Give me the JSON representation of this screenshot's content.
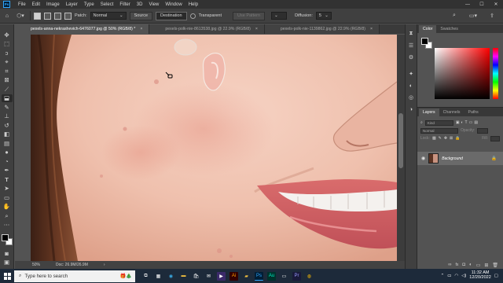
{
  "menubar": {
    "logo": "Ps",
    "items": [
      "File",
      "Edit",
      "Image",
      "Layer",
      "Type",
      "Select",
      "Filter",
      "3D",
      "View",
      "Window",
      "Help"
    ],
    "window_controls": [
      "—",
      "☐",
      "✕"
    ]
  },
  "options": {
    "patch_label": "Patch:",
    "patch_value": "Normal",
    "source_label": "Source",
    "destination_label": "Destination",
    "transparent_label": "Transparent",
    "use_pattern_label": "Use Pattern",
    "diffusion_label": "Diffusion:",
    "diffusion_value": "5"
  },
  "tabs": [
    {
      "label": "pexels-anna-nekrashevich-6476077.jpg @ 50% (RGB/8) *",
      "close": "×"
    },
    {
      "label": "pexels-polk-nie-8613538.jpg @ 22.9% (RGB/8)",
      "close": "×"
    },
    {
      "label": "pexels-polk-nie-1139862.jpg @ 22.9% (RGB/8)",
      "close": "×"
    }
  ],
  "status": {
    "zoom": "50%",
    "doc": "Doc: 26.9M/26.9M"
  },
  "color_panel": {
    "tabs": [
      "Color",
      "Swatches"
    ],
    "foreground": "#000000",
    "background": "#ffffff"
  },
  "layers_panel": {
    "tabs": [
      "Layers",
      "Channels",
      "Paths"
    ],
    "filter_label": "Kind",
    "blend_mode": "Normal",
    "opacity_label": "Opacity:",
    "lock_label": "Lock:",
    "fill_label": "Fill:",
    "layer_name": "Background"
  },
  "taskbar": {
    "search_placeholder": "Type here to search",
    "time": "11:32 AM",
    "date": "12/20/2022"
  },
  "colors": {
    "menubar_bg": "#323232",
    "panel_bg": "#535353",
    "taskbar_bg": "#1d2a3a"
  }
}
